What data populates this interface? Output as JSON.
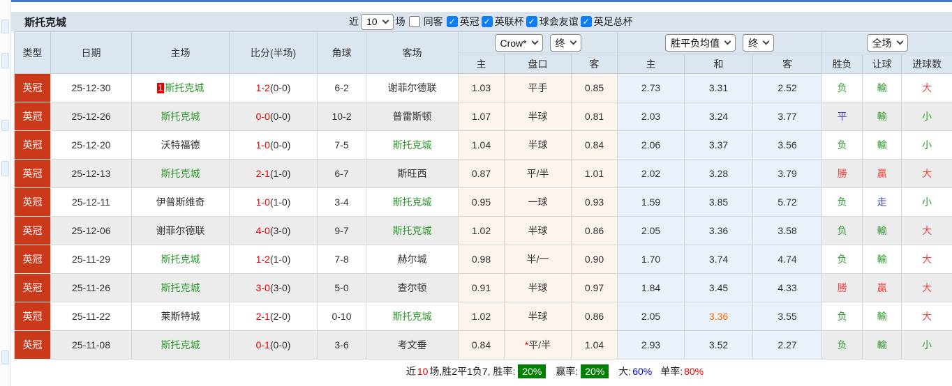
{
  "colors": {
    "accent_blue_line": "#3f7ac9",
    "filter_bar_bg": "#dbe3ee",
    "table_header_bg": "#dce6f0",
    "league_cell_bg": "#c9391a",
    "team_green": "#2e9b2e",
    "score_red": "#e60000",
    "result_red": "#f04545",
    "result_blue": "#4545e8",
    "highlight_orange": "#ff6600",
    "checkbox_blue": "#0d7ef5",
    "badge_green_bg": "#008000",
    "crow_col_bg": "#faf4ec",
    "avg_col_bg": "#e9f2fa"
  },
  "filter_bar": {
    "team_title": "斯托克城",
    "near_label": "近",
    "count_select": "10",
    "matches_label": "场",
    "same_away": {
      "label": "同客",
      "checked": false
    },
    "competitions": [
      {
        "label": "英冠",
        "checked": true
      },
      {
        "label": "英联杯",
        "checked": true
      },
      {
        "label": "球会友谊",
        "checked": true
      },
      {
        "label": "英足总杯",
        "checked": true
      }
    ]
  },
  "table": {
    "main_headers": [
      "类型",
      "日期",
      "主场",
      "比分(半场)",
      "角球",
      "客场"
    ],
    "odds_bookmaker_select": "Crow*",
    "odds_time_select": "终",
    "odds_sub_headers": [
      "主",
      "盘口",
      "客"
    ],
    "avg_select": "胜平负均值",
    "avg_time_select": "终",
    "avg_sub_headers": [
      "主",
      "和",
      "客"
    ],
    "scope_select": "全场",
    "result_sub_headers": [
      "胜负",
      "让球",
      "进球数"
    ],
    "rows": [
      {
        "league": "英冠",
        "date": "25-12-30",
        "home": "斯托克城",
        "home_green": true,
        "home_badge": "1",
        "score": "1-2",
        "half": "(0-0)",
        "corner": "6-2",
        "away": "谢菲尔德联",
        "away_green": false,
        "crow": {
          "home": "1.03",
          "handicap": "平手",
          "away": "0.85",
          "star": false
        },
        "avg": {
          "home": "2.73",
          "draw": "3.31",
          "away": "2.52",
          "draw_hl": false
        },
        "result": {
          "text": "负",
          "color": "green"
        },
        "handicap_result": {
          "text": "輸",
          "color": "green"
        },
        "goals": {
          "text": "大",
          "color": "red"
        }
      },
      {
        "league": "英冠",
        "date": "25-12-26",
        "home": "斯托克城",
        "home_green": true,
        "home_badge": "",
        "score": "0-0",
        "half": "(0-0)",
        "corner": "10-2",
        "away": "普雷斯顿",
        "away_green": false,
        "crow": {
          "home": "1.07",
          "handicap": "半球",
          "away": "0.81",
          "star": false
        },
        "avg": {
          "home": "2.03",
          "draw": "3.24",
          "away": "3.77",
          "draw_hl": false
        },
        "result": {
          "text": "平",
          "color": "blue"
        },
        "handicap_result": {
          "text": "輸",
          "color": "green"
        },
        "goals": {
          "text": "小",
          "color": "green"
        }
      },
      {
        "league": "英冠",
        "date": "25-12-20",
        "home": "沃特福德",
        "home_green": false,
        "home_badge": "",
        "score": "1-0",
        "half": "(0-0)",
        "corner": "7-5",
        "away": "斯托克城",
        "away_green": true,
        "crow": {
          "home": "1.04",
          "handicap": "半球",
          "away": "0.84",
          "star": false
        },
        "avg": {
          "home": "2.06",
          "draw": "3.37",
          "away": "3.56",
          "draw_hl": false
        },
        "result": {
          "text": "负",
          "color": "green"
        },
        "handicap_result": {
          "text": "輸",
          "color": "green"
        },
        "goals": {
          "text": "小",
          "color": "green"
        }
      },
      {
        "league": "英冠",
        "date": "25-12-13",
        "home": "斯托克城",
        "home_green": true,
        "home_badge": "",
        "score": "2-1",
        "half": "(1-0)",
        "corner": "6-7",
        "away": "斯旺西",
        "away_green": false,
        "crow": {
          "home": "0.87",
          "handicap": "平/半",
          "away": "1.01",
          "star": false
        },
        "avg": {
          "home": "2.02",
          "draw": "3.28",
          "away": "3.79",
          "draw_hl": false
        },
        "result": {
          "text": "勝",
          "color": "red"
        },
        "handicap_result": {
          "text": "贏",
          "color": "red"
        },
        "goals": {
          "text": "大",
          "color": "red"
        }
      },
      {
        "league": "英冠",
        "date": "25-12-11",
        "home": "伊普斯维奇",
        "home_green": false,
        "home_badge": "",
        "score": "1-0",
        "half": "(1-0)",
        "corner": "3-4",
        "away": "斯托克城",
        "away_green": true,
        "crow": {
          "home": "0.95",
          "handicap": "一球",
          "away": "0.93",
          "star": false
        },
        "avg": {
          "home": "1.59",
          "draw": "3.85",
          "away": "5.72",
          "draw_hl": false
        },
        "result": {
          "text": "负",
          "color": "green"
        },
        "handicap_result": {
          "text": "走",
          "color": "blue"
        },
        "goals": {
          "text": "小",
          "color": "green"
        }
      },
      {
        "league": "英冠",
        "date": "25-12-06",
        "home": "谢菲尔德联",
        "home_green": false,
        "home_badge": "",
        "score": "4-0",
        "half": "(3-0)",
        "corner": "9-7",
        "away": "斯托克城",
        "away_green": true,
        "crow": {
          "home": "1.02",
          "handicap": "半球",
          "away": "0.86",
          "star": false
        },
        "avg": {
          "home": "2.05",
          "draw": "3.36",
          "away": "3.58",
          "draw_hl": false
        },
        "result": {
          "text": "负",
          "color": "green"
        },
        "handicap_result": {
          "text": "輸",
          "color": "green"
        },
        "goals": {
          "text": "大",
          "color": "red"
        }
      },
      {
        "league": "英冠",
        "date": "25-11-29",
        "home": "斯托克城",
        "home_green": true,
        "home_badge": "",
        "score": "1-2",
        "half": "(1-0)",
        "corner": "7-8",
        "away": "赫尔城",
        "away_green": false,
        "crow": {
          "home": "0.98",
          "handicap": "半/一",
          "away": "0.90",
          "star": false
        },
        "avg": {
          "home": "1.70",
          "draw": "3.74",
          "away": "4.74",
          "draw_hl": false
        },
        "result": {
          "text": "负",
          "color": "green"
        },
        "handicap_result": {
          "text": "輸",
          "color": "green"
        },
        "goals": {
          "text": "大",
          "color": "red"
        }
      },
      {
        "league": "英冠",
        "date": "25-11-26",
        "home": "斯托克城",
        "home_green": true,
        "home_badge": "",
        "score": "3-0",
        "half": "(3-0)",
        "corner": "5-0",
        "away": "查尔顿",
        "away_green": false,
        "crow": {
          "home": "0.91",
          "handicap": "半球",
          "away": "0.97",
          "star": false
        },
        "avg": {
          "home": "1.84",
          "draw": "3.45",
          "away": "4.33",
          "draw_hl": false
        },
        "result": {
          "text": "勝",
          "color": "red"
        },
        "handicap_result": {
          "text": "贏",
          "color": "red"
        },
        "goals": {
          "text": "大",
          "color": "red"
        }
      },
      {
        "league": "英冠",
        "date": "25-11-22",
        "home": "莱斯特城",
        "home_green": false,
        "home_badge": "",
        "score": "2-1",
        "half": "(2-0)",
        "corner": "0-10",
        "away": "斯托克城",
        "away_green": true,
        "crow": {
          "home": "1.02",
          "handicap": "半球",
          "away": "0.86",
          "star": false
        },
        "avg": {
          "home": "2.05",
          "draw": "3.36",
          "away": "3.55",
          "draw_hl": true
        },
        "result": {
          "text": "负",
          "color": "green"
        },
        "handicap_result": {
          "text": "輸",
          "color": "green"
        },
        "goals": {
          "text": "大",
          "color": "red"
        }
      },
      {
        "league": "英冠",
        "date": "25-11-08",
        "home": "斯托克城",
        "home_green": true,
        "home_badge": "",
        "score": "0-1",
        "half": "(0-0)",
        "corner": "3-6",
        "away": "考文垂",
        "away_green": false,
        "crow": {
          "home": "0.84",
          "handicap": "平/半",
          "away": "1.04",
          "star": true
        },
        "avg": {
          "home": "2.93",
          "draw": "3.52",
          "away": "2.27",
          "draw_hl": false
        },
        "result": {
          "text": "负",
          "color": "green"
        },
        "handicap_result": {
          "text": "輸",
          "color": "green"
        },
        "goals": {
          "text": "小",
          "color": "green"
        }
      }
    ]
  },
  "summary": {
    "near_label": "近",
    "count": "10",
    "record_text": "场,胜2平1负7, 胜率:",
    "win_rate": "20%",
    "handicap_win_label": "赢率:",
    "handicap_win_rate": "20%",
    "big_label": "大:",
    "big_rate": "60%",
    "single_label": "单率:",
    "single_rate": "80%"
  }
}
